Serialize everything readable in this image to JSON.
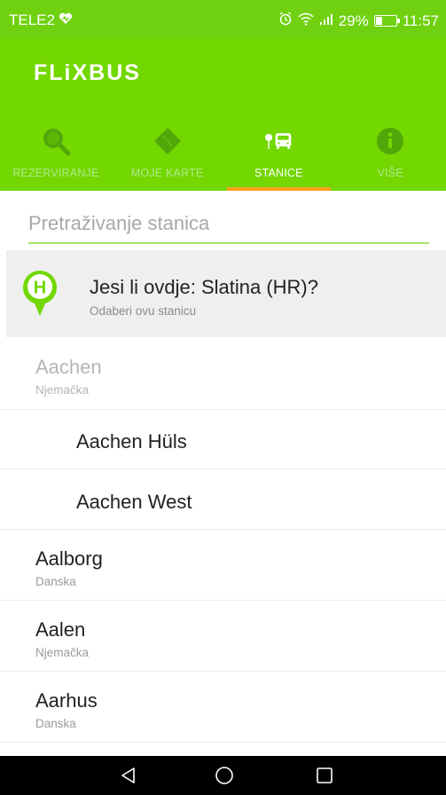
{
  "status_bar": {
    "carrier": "TELE2",
    "battery_percent": "29%",
    "battery_level": 0.29,
    "time": "11:57",
    "icons": [
      "heart-icon",
      "alarm-icon",
      "wifi-icon",
      "signal-icon",
      "battery-icon"
    ]
  },
  "app": {
    "logo": "FLiXBUS",
    "brand_color": "#73d700",
    "accent_color": "#ff9e1b"
  },
  "tabs": [
    {
      "label": "REZERVIRANJE",
      "icon": "search-icon",
      "active": false
    },
    {
      "label": "MOJE KARTE",
      "icon": "ticket-icon",
      "active": false
    },
    {
      "label": "STANICE",
      "icon": "bus-stop-icon",
      "active": true
    },
    {
      "label": "VIŠE",
      "icon": "info-icon",
      "active": false
    }
  ],
  "search": {
    "placeholder": "Pretraživanje stanica",
    "value": ""
  },
  "nearby": {
    "title": "Jesi li ovdje: Slatina (HR)?",
    "subtitle": "Odaberi ovu stanicu",
    "icon": "bus-stop-pin-icon"
  },
  "stations": [
    {
      "name": "Aachen",
      "country": "Njemačka",
      "disabled": true,
      "child": false
    },
    {
      "name": "Aachen Hüls",
      "country": "",
      "disabled": false,
      "child": true
    },
    {
      "name": "Aachen West",
      "country": "",
      "disabled": false,
      "child": true
    },
    {
      "name": "Aalborg",
      "country": "Danska",
      "disabled": false,
      "child": false
    },
    {
      "name": "Aalen",
      "country": "Njemačka",
      "disabled": false,
      "child": false
    },
    {
      "name": "Aarhus",
      "country": "Danska",
      "disabled": false,
      "child": false
    }
  ],
  "nav_bar": [
    "back-icon",
    "home-icon",
    "recents-icon"
  ]
}
